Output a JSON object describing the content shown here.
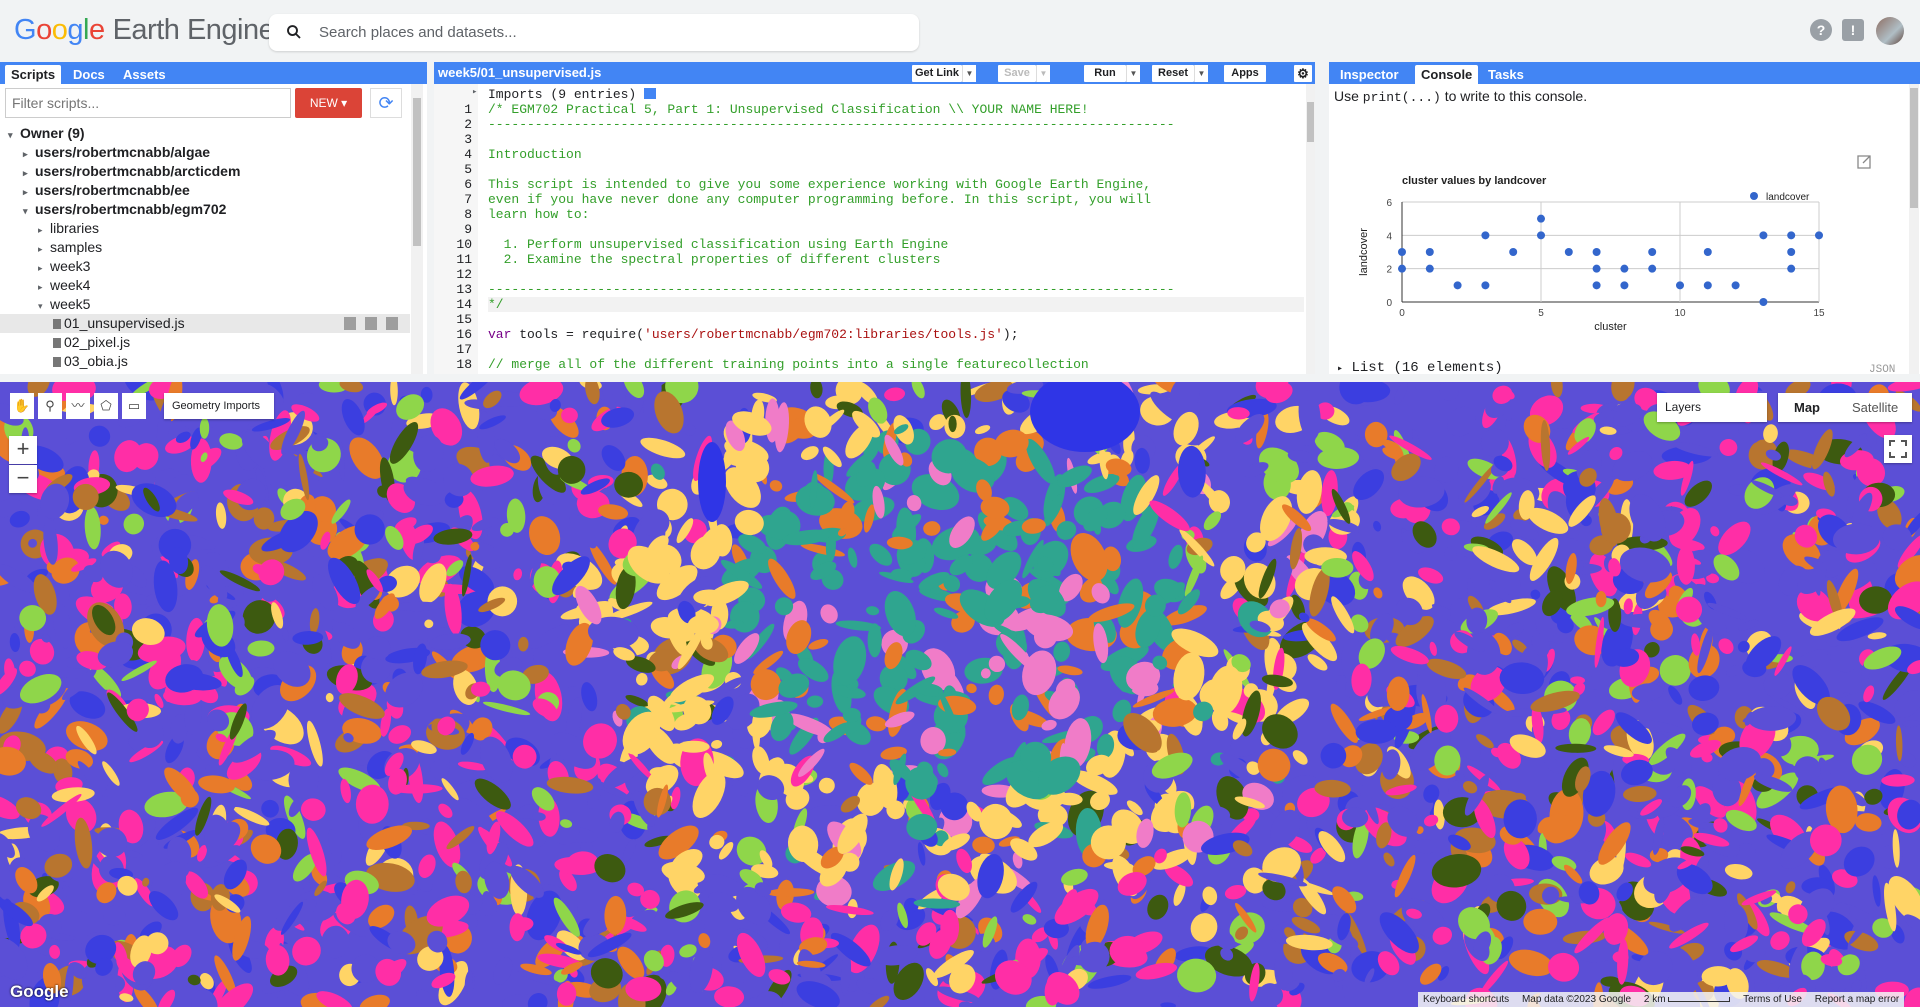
{
  "header": {
    "logo_google": "Google",
    "logo_product": "Earth Engine",
    "search_placeholder": "Search places and datasets...",
    "icons": [
      "help-icon",
      "feedback-icon",
      "avatar"
    ]
  },
  "left_panel": {
    "tabs": [
      "Scripts",
      "Docs",
      "Assets"
    ],
    "active_tab": "Scripts",
    "filter_placeholder": "Filter scripts...",
    "new_button": "NEW",
    "tree": [
      {
        "label": "Owner (9)",
        "level": 0,
        "bold": true,
        "expanded": true
      },
      {
        "label": "users/robertmcnabb/algae",
        "level": 1,
        "bold": true,
        "expanded": false
      },
      {
        "label": "users/robertmcnabb/arcticdem",
        "level": 1,
        "bold": true,
        "expanded": false
      },
      {
        "label": "users/robertmcnabb/ee",
        "level": 1,
        "bold": true,
        "expanded": false
      },
      {
        "label": "users/robertmcnabb/egm702",
        "level": 1,
        "bold": true,
        "expanded": true
      },
      {
        "label": "libraries",
        "level": 2,
        "expanded": false
      },
      {
        "label": "samples",
        "level": 2,
        "expanded": false
      },
      {
        "label": "week3",
        "level": 2,
        "expanded": false
      },
      {
        "label": "week4",
        "level": 2,
        "expanded": false
      },
      {
        "label": "week5",
        "level": 2,
        "expanded": true
      },
      {
        "label": "01_unsupervised.js",
        "level": 3,
        "file": true,
        "selected": true
      },
      {
        "label": "02_pixel.js",
        "level": 3,
        "file": true
      },
      {
        "label": "03_obia.js",
        "level": 3,
        "file": true
      }
    ]
  },
  "editor": {
    "title": "week5/01_unsupervised.js",
    "buttons": {
      "get_link": "Get Link",
      "save": "Save",
      "run": "Run",
      "reset": "Reset",
      "apps": "Apps"
    },
    "imports_line": "Imports (9 entries)",
    "lines": [
      {
        "n": "1",
        "text": "/* EGM702 Practical 5, Part 1: Unsupervised Classification \\\\ YOUR NAME HERE!",
        "kind": "cmt"
      },
      {
        "n": "2",
        "text": "----------------------------------------------------------------------------------------",
        "kind": "cmt"
      },
      {
        "n": "3",
        "text": "",
        "kind": "cmt"
      },
      {
        "n": "4",
        "text": "Introduction",
        "kind": "cmt"
      },
      {
        "n": "5",
        "text": "",
        "kind": "cmt"
      },
      {
        "n": "6",
        "text": "This script is intended to give you some experience working with Google Earth Engine,",
        "kind": "cmt"
      },
      {
        "n": "7",
        "text": "even if you have never done any computer programming before. In this script, you will",
        "kind": "cmt"
      },
      {
        "n": "8",
        "text": "learn how to:",
        "kind": "cmt"
      },
      {
        "n": "9",
        "text": "",
        "kind": "cmt"
      },
      {
        "n": "10",
        "text": "  1. Perform unsupervised classification using Earth Engine",
        "kind": "cmt"
      },
      {
        "n": "11",
        "text": "  2. Examine the spectral properties of different clusters",
        "kind": "cmt"
      },
      {
        "n": "12",
        "text": "",
        "kind": "cmt"
      },
      {
        "n": "13",
        "text": "----------------------------------------------------------------------------------------",
        "kind": "cmt"
      },
      {
        "n": "14",
        "text": "*/",
        "kind": "cmt"
      },
      {
        "n": "15",
        "text": "",
        "kind": "plain"
      },
      {
        "n": "16",
        "text": "var tools = require('users/robertmcnabb/egm702:libraries/tools.js');",
        "kind": "code"
      },
      {
        "n": "17",
        "text": "",
        "kind": "plain"
      },
      {
        "n": "18",
        "text": "// merge all of the different training points into a single featurecollection",
        "kind": "cmt"
      }
    ]
  },
  "right_panel": {
    "tabs": [
      "Inspector",
      "Console",
      "Tasks"
    ],
    "active_tab": "Console",
    "hint_prefix": "Use ",
    "hint_code": "print(...)",
    "hint_suffix": " to write to this console.",
    "list_line": "List (16 elements)",
    "json_label": "JSON"
  },
  "chart_data": {
    "type": "scatter",
    "title": "cluster values by landcover",
    "xlabel": "cluster",
    "ylabel": "landcover",
    "xlim": [
      0,
      15
    ],
    "ylim": [
      0,
      6
    ],
    "xticks": [
      0,
      5,
      10,
      15
    ],
    "yticks": [
      0,
      2,
      4,
      6
    ],
    "legend_position": "top-right",
    "grid": true,
    "series": [
      {
        "name": "landcover",
        "color": "#3366cc",
        "points": [
          [
            0,
            2
          ],
          [
            0,
            3
          ],
          [
            1,
            2
          ],
          [
            1,
            3
          ],
          [
            2,
            1
          ],
          [
            3,
            1
          ],
          [
            3,
            4
          ],
          [
            4,
            3
          ],
          [
            5,
            4
          ],
          [
            5,
            5
          ],
          [
            6,
            3
          ],
          [
            7,
            1
          ],
          [
            7,
            2
          ],
          [
            7,
            3
          ],
          [
            8,
            1
          ],
          [
            8,
            2
          ],
          [
            9,
            2
          ],
          [
            9,
            3
          ],
          [
            10,
            1
          ],
          [
            11,
            1
          ],
          [
            11,
            3
          ],
          [
            12,
            1
          ],
          [
            13,
            0
          ],
          [
            13,
            4
          ],
          [
            14,
            2
          ],
          [
            14,
            3
          ],
          [
            14,
            4
          ],
          [
            15,
            4
          ]
        ]
      }
    ]
  },
  "map": {
    "drawing_tools": [
      "hand-icon",
      "marker-icon",
      "line-icon",
      "polygon-icon",
      "rectangle-icon"
    ],
    "geometry_imports": "Geometry Imports",
    "layers_label": "Layers",
    "map_type": [
      "Map",
      "Satellite"
    ],
    "active_map_type": "Map",
    "zoom_in": "+",
    "zoom_out": "−",
    "google_logo": "Google",
    "attribution": [
      "Keyboard shortcuts",
      "Map data ©2023 Google",
      "2 km",
      "Terms of Use",
      "Report a map error"
    ]
  }
}
